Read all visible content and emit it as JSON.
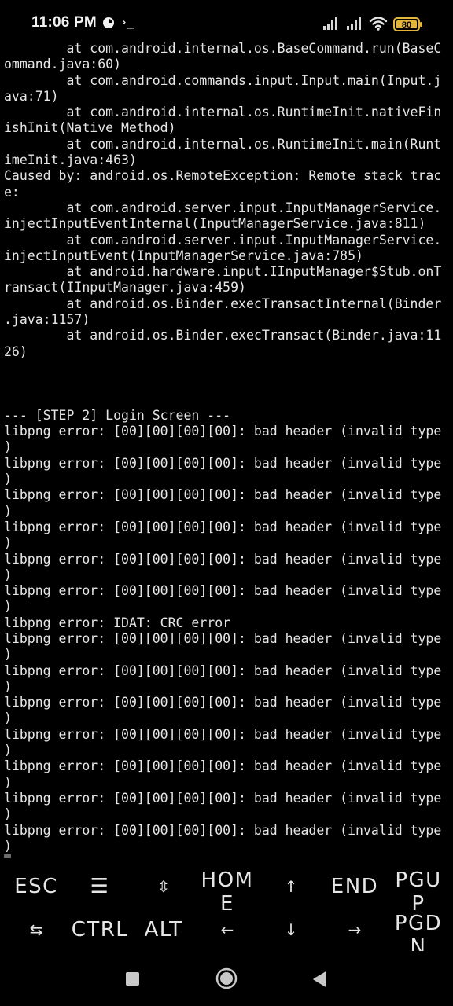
{
  "status_bar": {
    "time": "11:06 PM",
    "term_glyph": "›_",
    "battery_level": "80",
    "icons": [
      "app-notification-icon",
      "terminal-icon",
      "signal-icon",
      "signal-icon",
      "wifi-icon",
      "battery-icon"
    ]
  },
  "terminal": {
    "lines": [
      "        at com.android.internal.os.BaseCommand.run(BaseC",
      "ommand.java:60)",
      "        at com.android.commands.input.Input.main(Input.j",
      "ava:71)",
      "        at com.android.internal.os.RuntimeInit.nativeFin",
      "ishInit(Native Method)",
      "        at com.android.internal.os.RuntimeInit.main(Runt",
      "imeInit.java:463)",
      "Caused by: android.os.RemoteException: Remote stack trac",
      "e:",
      "        at com.android.server.input.InputManagerService.",
      "injectInputEventInternal(InputManagerService.java:811)",
      "        at com.android.server.input.InputManagerService.",
      "injectInputEvent(InputManagerService.java:785)",
      "        at android.hardware.input.IInputManager$Stub.onT",
      "ransact(IInputManager.java:459)",
      "        at android.os.Binder.execTransactInternal(Binder",
      ".java:1157)",
      "        at android.os.Binder.execTransact(Binder.java:11",
      "26)",
      "",
      "",
      "",
      "--- [STEP 2] Login Screen ---",
      "libpng error: [00][00][00][00]: bad header (invalid type",
      ")",
      "libpng error: [00][00][00][00]: bad header (invalid type",
      ")",
      "libpng error: [00][00][00][00]: bad header (invalid type",
      ")",
      "libpng error: [00][00][00][00]: bad header (invalid type",
      ")",
      "libpng error: [00][00][00][00]: bad header (invalid type",
      ")",
      "libpng error: [00][00][00][00]: bad header (invalid type",
      ")",
      "libpng error: IDAT: CRC error",
      "libpng error: [00][00][00][00]: bad header (invalid type",
      ")",
      "libpng error: [00][00][00][00]: bad header (invalid type",
      ")",
      "libpng error: [00][00][00][00]: bad header (invalid type",
      ")",
      "libpng error: [00][00][00][00]: bad header (invalid type",
      ")",
      "libpng error: [00][00][00][00]: bad header (invalid type",
      ")",
      "libpng error: [00][00][00][00]: bad header (invalid type",
      ")",
      "libpng error: [00][00][00][00]: bad header (invalid type",
      ")"
    ]
  },
  "extra_keys": {
    "row1": {
      "esc": "ESC",
      "menu": "☰",
      "updown": "⇳",
      "home": "HOM\nE",
      "up": "↑",
      "end": "END",
      "pgup": "PGU\nP"
    },
    "row2": {
      "tab": "⇆",
      "ctrl": "CTRL",
      "alt": "ALT",
      "left": "←",
      "down": "↓",
      "right": "→",
      "pgdn": "PGD\nN"
    }
  },
  "nav_bar": {
    "icons": [
      "recents-icon",
      "home-icon",
      "back-icon"
    ]
  },
  "colors": {
    "background": "#000000",
    "text": "#e6e6e6",
    "cursor": "#6b6b6b",
    "battery_fill": "#e3b53a"
  }
}
